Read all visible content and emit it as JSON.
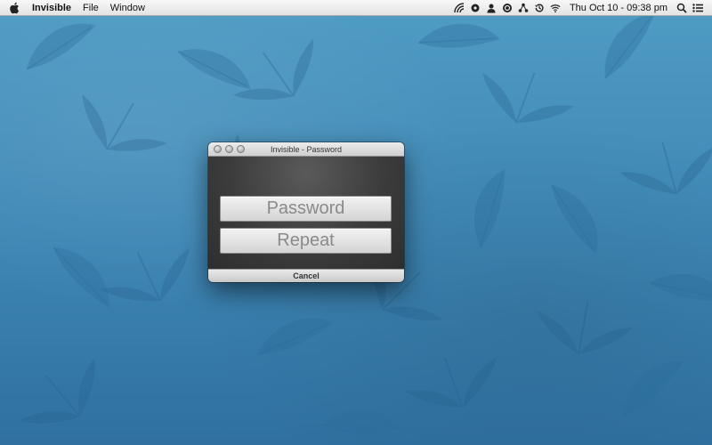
{
  "menubar": {
    "apple_icon": "apple-logo-icon",
    "app_name": "Invisible",
    "menus": [
      "File",
      "Window"
    ],
    "status_icons": [
      "wifi-signal-icon",
      "gear-icon",
      "user-icon",
      "vpn-icon",
      "network-icon",
      "time-machine-icon",
      "wifi-icon"
    ],
    "clock": "Thu Oct 10 - 09:38 pm",
    "search_icon": "spotlight-search-icon",
    "list_icon": "notification-list-icon"
  },
  "window": {
    "title": "Invisible - Password",
    "password_placeholder": "Password",
    "repeat_placeholder": "Repeat",
    "cancel_label": "Cancel"
  },
  "colors": {
    "wallpaper_top": "#4f9cc4",
    "wallpaper_bottom": "#2f70a0",
    "dialog_background": "#3c3c3c"
  }
}
